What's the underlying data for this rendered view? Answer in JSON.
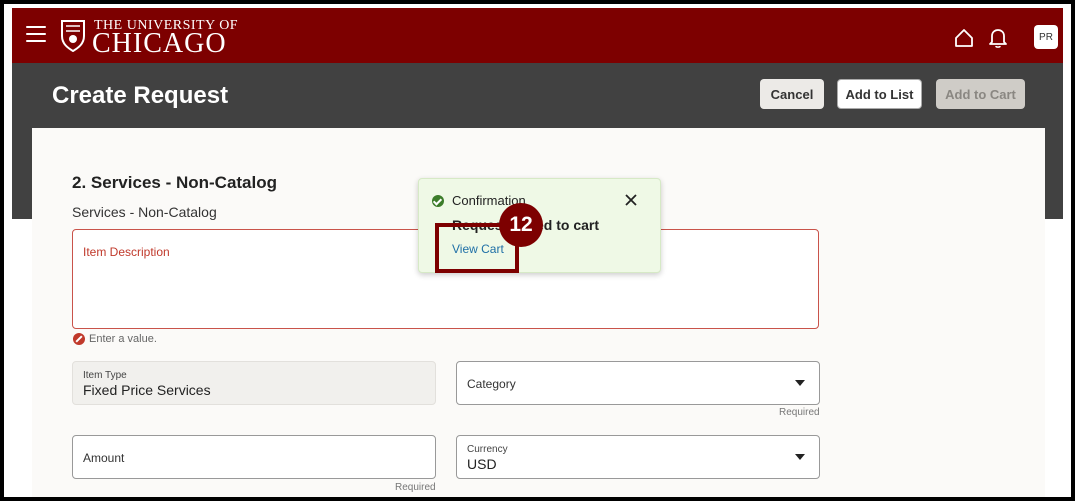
{
  "header": {
    "logo_top": "THE UNIVERSITY OF",
    "logo_main": "CHICAGO",
    "avatar_initials": "PR",
    "brand_color": "#7d0000"
  },
  "page": {
    "title": "Create Request",
    "cancel_label": "Cancel",
    "add_to_list_label": "Add to List",
    "add_to_cart_label": "Add to Cart"
  },
  "form": {
    "section_title": "2. Services - Non-Catalog",
    "section_subtitle": "Services - Non-Catalog",
    "description_label": "Item Description",
    "description_error": "Enter a value.",
    "item_type_label": "Item Type",
    "item_type_value": "Fixed Price Services",
    "category_label": "Category",
    "category_required": "Required",
    "amount_label": "Amount",
    "amount_required": "Required",
    "currency_label": "Currency",
    "currency_value": "USD"
  },
  "toast": {
    "title": "Confirmation",
    "message": "Request added to cart",
    "link": "View Cart"
  },
  "annotation": {
    "step_number": "12"
  }
}
